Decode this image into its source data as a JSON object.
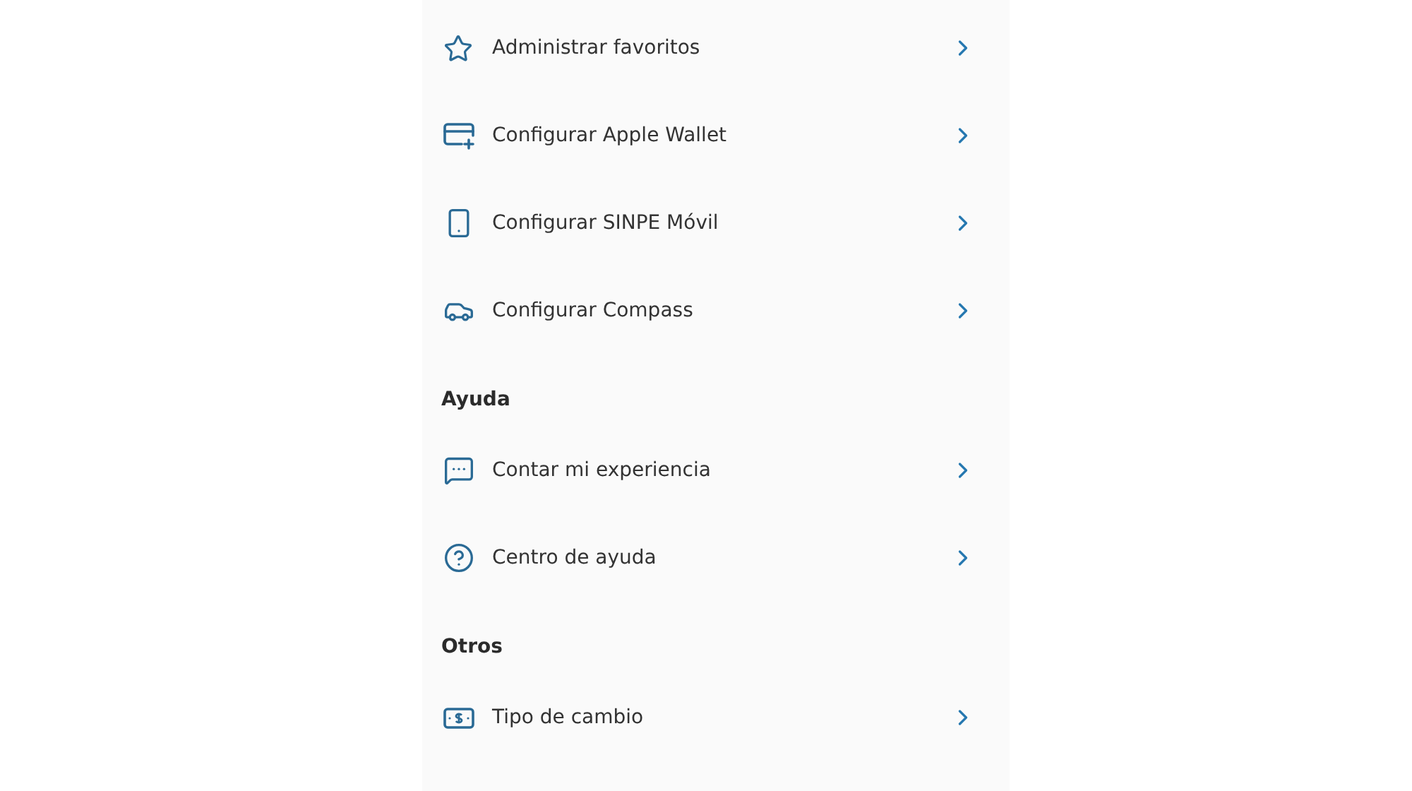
{
  "sections": [
    {
      "items": [
        {
          "label": "Administrar favoritos"
        },
        {
          "label": "Configurar Apple Wallet"
        },
        {
          "label": "Configurar SINPE Móvil"
        },
        {
          "label": "Configurar Compass"
        }
      ]
    },
    {
      "title": "Ayuda",
      "items": [
        {
          "label": "Contar mi experiencia"
        },
        {
          "label": "Centro de ayuda"
        }
      ]
    },
    {
      "title": "Otros",
      "items": [
        {
          "label": "Tipo de cambio"
        }
      ]
    }
  ]
}
